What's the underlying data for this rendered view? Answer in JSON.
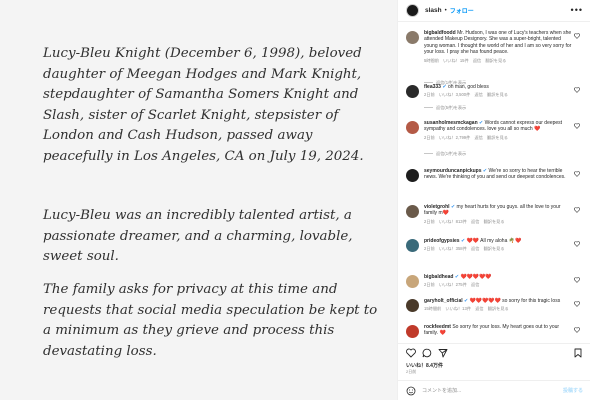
{
  "post": {
    "paragraphs": [
      "Lucy-Bleu Knight (December 6, 1998), beloved daughter of Meegan Hodges and Mark Knight, stepdaughter of Samantha Somers Knight and Slash, sister of Scarlet Knight, stepsister of London and Cash Hudson, passed away peacefully in Los Angeles, CA on July 19, 2024.",
      "Lucy-Bleu was an incredibly talented artist, a passionate dreamer, and a charming, lovable, sweet soul.",
      "The family asks for privacy at this time and requests that social media speculation be kept to a minimum as they grieve and process this devastating loss."
    ]
  },
  "header": {
    "username": "slash",
    "dot": "•",
    "follow_label": "フォロー",
    "more": "•••"
  },
  "comments": [
    {
      "user": "bigbaldfoodd",
      "text": "Mr. Hudson, I was one of Lucy's teachers when she attended Makeup Designory. She was a super-bright, talented young woman. I thought the world of her and I am so very sorry for your loss. I pray she has found peace.",
      "time": "5時間前",
      "likes": "いいね！15件",
      "reply": "返信",
      "translate": "翻訳を見る",
      "replies": "返信(1件)を表示",
      "avatar_color": "#8a7a6a"
    },
    {
      "user": "flea333",
      "text": "oh man, god bless",
      "time": "2日前",
      "likes": "いいね！3,500件",
      "reply": "返信",
      "translate": "翻訳を見る",
      "replies": "返信(5件)を表示",
      "avatar_color": "#2a2a2a",
      "verified": true
    },
    {
      "user": "susanholmesmckagan",
      "text": "Words cannot express our deepest sympathy and condolences. love you all so much ❤️",
      "time": "2日前",
      "likes": "いいね！2,799件",
      "reply": "返信",
      "translate": "翻訳を見る",
      "replies": "返信(1件)を表示",
      "avatar_color": "#b45a46",
      "verified": true
    },
    {
      "user": "seymourduncanpickups",
      "text": "We're so sorry to hear the terrible news. We're thinking of you and send our deepest condolences.",
      "time": "",
      "likes": "",
      "reply": "",
      "translate": "",
      "replies": "",
      "avatar_color": "#1d1d1d",
      "verified": true
    },
    {
      "user": "violetgrohl",
      "text": "my heart hurts for you guys. all the love to your family m❤️",
      "time": "2日前",
      "likes": "いいね！813件",
      "reply": "返信",
      "translate": "翻訳を見る",
      "replies": "",
      "avatar_color": "#6a5a4a",
      "verified": true
    },
    {
      "user": "prideofgypsies",
      "text": "❤️❤️ All my aloha 🌴❤️",
      "time": "2日前",
      "likes": "いいね！358件",
      "reply": "返信",
      "translate": "翻訳を見る",
      "replies": "",
      "avatar_color": "#3a6a7a",
      "verified": true
    },
    {
      "user": "bigbaldhead",
      "text": "❤️❤️❤️❤️❤️",
      "time": "2日前",
      "likes": "いいね！275件",
      "reply": "返信",
      "translate": "",
      "replies": "",
      "avatar_color": "#c8a67a",
      "verified": true
    },
    {
      "user": "garyholt_official",
      "text": "❤️❤️❤️❤️❤️ so sorry for this tragic loss",
      "time": "15時間前",
      "likes": "いいね！13件",
      "reply": "返信",
      "translate": "翻訳を見る",
      "replies": "",
      "avatar_color": "#4a3a2a",
      "verified": true
    },
    {
      "user": "rockfeedmt",
      "text": "So sorry for your loss. My heart goes out to your family. ❤️",
      "time": "",
      "likes": "",
      "reply": "",
      "translate": "",
      "replies": "",
      "avatar_color": "#c03a2a"
    }
  ],
  "footer": {
    "likes": "いいね！8.4万件",
    "date": "2日前",
    "composer_placeholder": "コメントを追加...",
    "post_label": "投稿する"
  },
  "colors": {
    "link_blue": "#0095f6",
    "verified_blue": "#3897f0",
    "meta_gray": "#8e8e8e"
  }
}
